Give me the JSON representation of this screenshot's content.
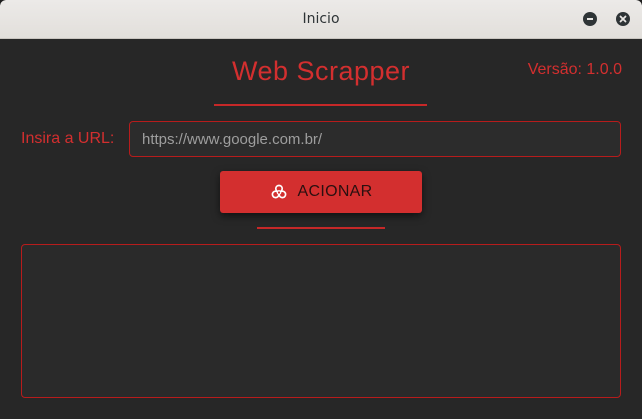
{
  "window": {
    "title": "Inicio",
    "controls": [
      "minimize-icon",
      "close-icon"
    ]
  },
  "header": {
    "app_title": "Web Scrapper",
    "version": "Versão: 1.0.0"
  },
  "form": {
    "url_label": "Insira a URL:",
    "url_value": "",
    "url_placeholder": "https://www.google.com.br/",
    "button_label": "ACIONAR",
    "button_icon": "biohazard-icon"
  },
  "output": {
    "text": ""
  },
  "colors": {
    "accent": "#d32f2f",
    "background": "#272727",
    "border": "#b71c1c"
  }
}
